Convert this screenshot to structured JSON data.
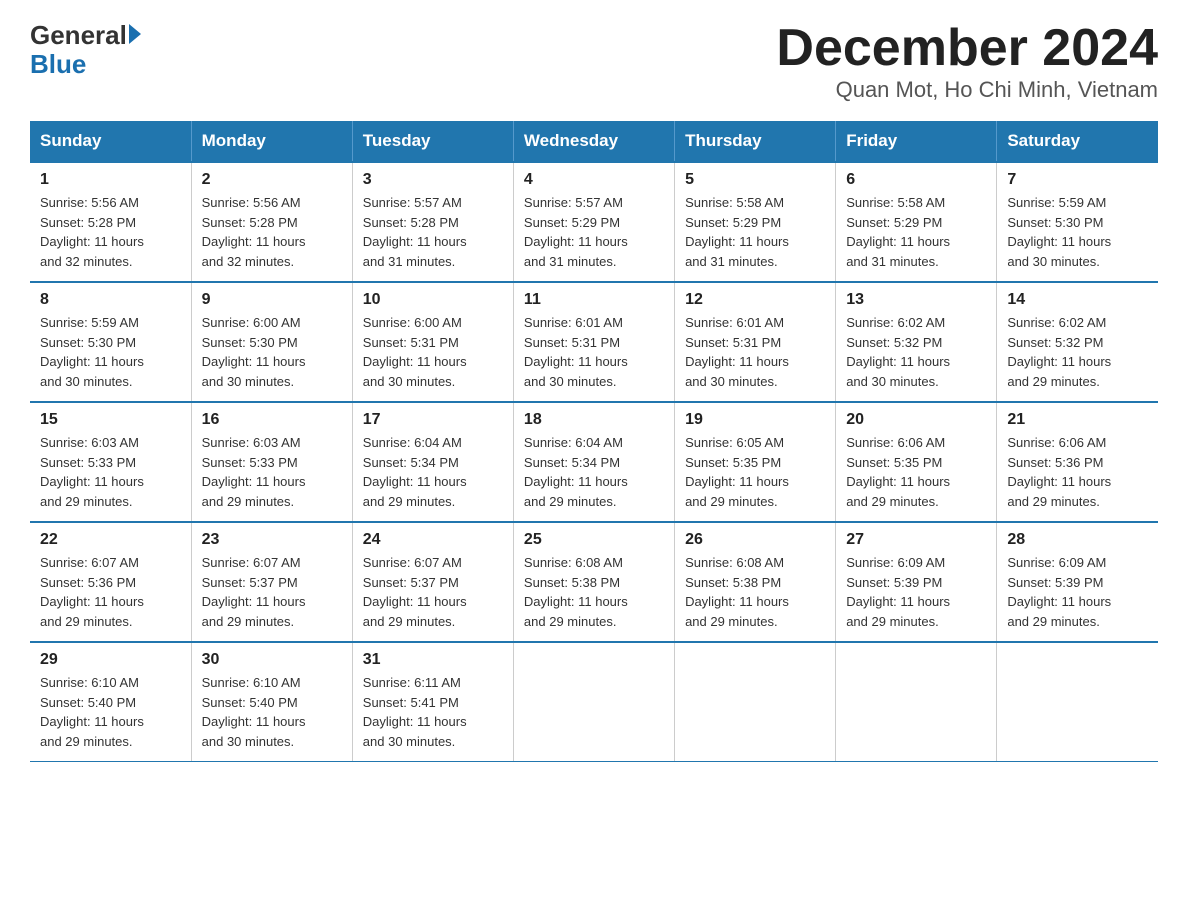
{
  "header": {
    "logo_general": "General",
    "logo_blue": "Blue",
    "title": "December 2024",
    "subtitle": "Quan Mot, Ho Chi Minh, Vietnam"
  },
  "days_of_week": [
    "Sunday",
    "Monday",
    "Tuesday",
    "Wednesday",
    "Thursday",
    "Friday",
    "Saturday"
  ],
  "weeks": [
    [
      {
        "num": "1",
        "sunrise": "5:56 AM",
        "sunset": "5:28 PM",
        "daylight": "11 hours and 32 minutes."
      },
      {
        "num": "2",
        "sunrise": "5:56 AM",
        "sunset": "5:28 PM",
        "daylight": "11 hours and 32 minutes."
      },
      {
        "num": "3",
        "sunrise": "5:57 AM",
        "sunset": "5:28 PM",
        "daylight": "11 hours and 31 minutes."
      },
      {
        "num": "4",
        "sunrise": "5:57 AM",
        "sunset": "5:29 PM",
        "daylight": "11 hours and 31 minutes."
      },
      {
        "num": "5",
        "sunrise": "5:58 AM",
        "sunset": "5:29 PM",
        "daylight": "11 hours and 31 minutes."
      },
      {
        "num": "6",
        "sunrise": "5:58 AM",
        "sunset": "5:29 PM",
        "daylight": "11 hours and 31 minutes."
      },
      {
        "num": "7",
        "sunrise": "5:59 AM",
        "sunset": "5:30 PM",
        "daylight": "11 hours and 30 minutes."
      }
    ],
    [
      {
        "num": "8",
        "sunrise": "5:59 AM",
        "sunset": "5:30 PM",
        "daylight": "11 hours and 30 minutes."
      },
      {
        "num": "9",
        "sunrise": "6:00 AM",
        "sunset": "5:30 PM",
        "daylight": "11 hours and 30 minutes."
      },
      {
        "num": "10",
        "sunrise": "6:00 AM",
        "sunset": "5:31 PM",
        "daylight": "11 hours and 30 minutes."
      },
      {
        "num": "11",
        "sunrise": "6:01 AM",
        "sunset": "5:31 PM",
        "daylight": "11 hours and 30 minutes."
      },
      {
        "num": "12",
        "sunrise": "6:01 AM",
        "sunset": "5:31 PM",
        "daylight": "11 hours and 30 minutes."
      },
      {
        "num": "13",
        "sunrise": "6:02 AM",
        "sunset": "5:32 PM",
        "daylight": "11 hours and 30 minutes."
      },
      {
        "num": "14",
        "sunrise": "6:02 AM",
        "sunset": "5:32 PM",
        "daylight": "11 hours and 29 minutes."
      }
    ],
    [
      {
        "num": "15",
        "sunrise": "6:03 AM",
        "sunset": "5:33 PM",
        "daylight": "11 hours and 29 minutes."
      },
      {
        "num": "16",
        "sunrise": "6:03 AM",
        "sunset": "5:33 PM",
        "daylight": "11 hours and 29 minutes."
      },
      {
        "num": "17",
        "sunrise": "6:04 AM",
        "sunset": "5:34 PM",
        "daylight": "11 hours and 29 minutes."
      },
      {
        "num": "18",
        "sunrise": "6:04 AM",
        "sunset": "5:34 PM",
        "daylight": "11 hours and 29 minutes."
      },
      {
        "num": "19",
        "sunrise": "6:05 AM",
        "sunset": "5:35 PM",
        "daylight": "11 hours and 29 minutes."
      },
      {
        "num": "20",
        "sunrise": "6:06 AM",
        "sunset": "5:35 PM",
        "daylight": "11 hours and 29 minutes."
      },
      {
        "num": "21",
        "sunrise": "6:06 AM",
        "sunset": "5:36 PM",
        "daylight": "11 hours and 29 minutes."
      }
    ],
    [
      {
        "num": "22",
        "sunrise": "6:07 AM",
        "sunset": "5:36 PM",
        "daylight": "11 hours and 29 minutes."
      },
      {
        "num": "23",
        "sunrise": "6:07 AM",
        "sunset": "5:37 PM",
        "daylight": "11 hours and 29 minutes."
      },
      {
        "num": "24",
        "sunrise": "6:07 AM",
        "sunset": "5:37 PM",
        "daylight": "11 hours and 29 minutes."
      },
      {
        "num": "25",
        "sunrise": "6:08 AM",
        "sunset": "5:38 PM",
        "daylight": "11 hours and 29 minutes."
      },
      {
        "num": "26",
        "sunrise": "6:08 AM",
        "sunset": "5:38 PM",
        "daylight": "11 hours and 29 minutes."
      },
      {
        "num": "27",
        "sunrise": "6:09 AM",
        "sunset": "5:39 PM",
        "daylight": "11 hours and 29 minutes."
      },
      {
        "num": "28",
        "sunrise": "6:09 AM",
        "sunset": "5:39 PM",
        "daylight": "11 hours and 29 minutes."
      }
    ],
    [
      {
        "num": "29",
        "sunrise": "6:10 AM",
        "sunset": "5:40 PM",
        "daylight": "11 hours and 29 minutes."
      },
      {
        "num": "30",
        "sunrise": "6:10 AM",
        "sunset": "5:40 PM",
        "daylight": "11 hours and 30 minutes."
      },
      {
        "num": "31",
        "sunrise": "6:11 AM",
        "sunset": "5:41 PM",
        "daylight": "11 hours and 30 minutes."
      },
      null,
      null,
      null,
      null
    ]
  ],
  "labels": {
    "sunrise": "Sunrise:",
    "sunset": "Sunset:",
    "daylight": "Daylight:"
  }
}
